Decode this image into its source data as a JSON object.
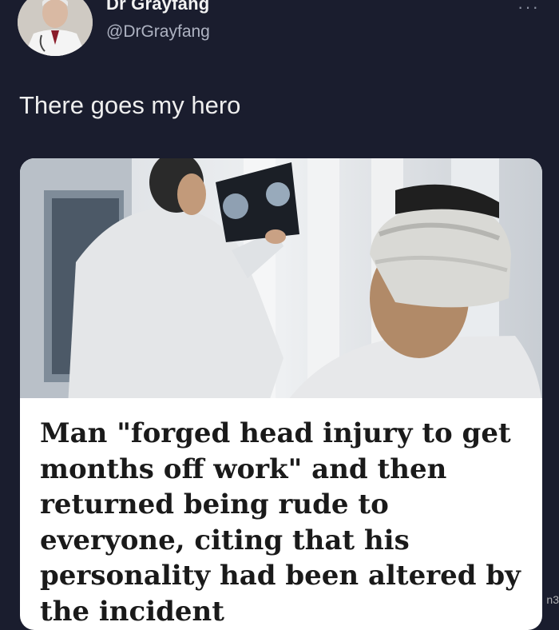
{
  "tweet": {
    "display_name": "Dr Grayfang",
    "handle": "@DrGrayfang",
    "more_label": "···",
    "text": "There goes my hero"
  },
  "card": {
    "headline": "Man \"forged head injury to get months off work\" and then returned being rude to everyone, citing that his personality had been altered by the incident",
    "watermark": "n3"
  },
  "icons": {
    "more": "more-options-icon",
    "avatar": "doctor-avatar"
  },
  "colors": {
    "background": "#1a1d2e",
    "card": "#ffffff",
    "text_primary": "#eeeeee",
    "text_secondary": "#aeb3c2"
  }
}
